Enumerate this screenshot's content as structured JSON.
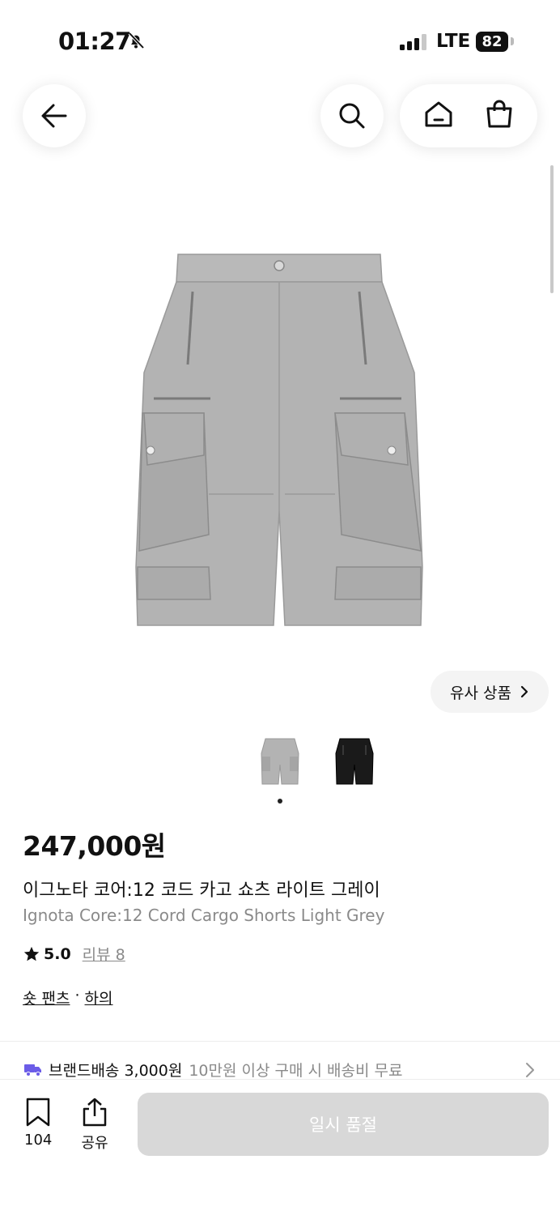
{
  "status_bar": {
    "time": "01:27",
    "network": "LTE",
    "battery": "82"
  },
  "similar": {
    "label": "유사 상품"
  },
  "product": {
    "price": "247,000원",
    "name_ko": "이그노타 코어:12 코드 카고 쇼츠 라이트 그레이",
    "name_en": "Ignota Core:12 Cord Cargo Shorts Light Grey",
    "rating": "5.0",
    "review_label": "리뷰 8",
    "category_1": "숏 팬츠",
    "separator": "·",
    "category_2": "하의"
  },
  "shipping": {
    "label": "브랜드배송 3,000원",
    "note": "10만원 이상 구매 시 배송비 무료"
  },
  "bottom_bar": {
    "bookmark_count": "104",
    "share_label": "공유",
    "cta_label": "일시 품절"
  },
  "icons": {
    "back": "arrow-left-icon",
    "search": "search-icon",
    "home": "home-icon",
    "cart": "shopping-bag-icon"
  },
  "colors": {
    "cta_disabled": "#d8d8d8",
    "muted_text": "#8a8a8a"
  }
}
